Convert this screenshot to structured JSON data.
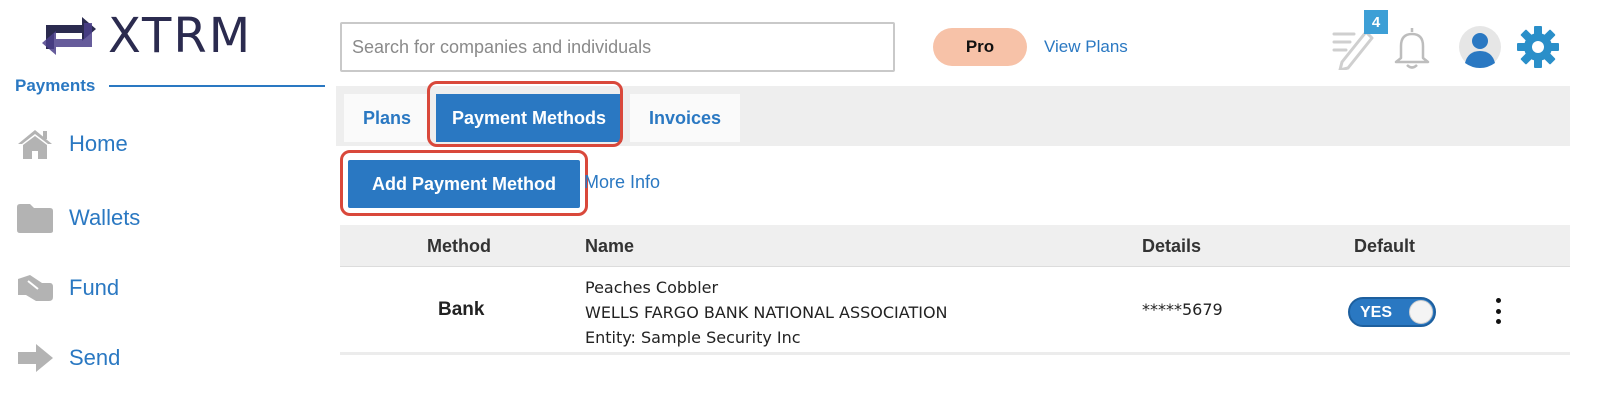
{
  "brand": {
    "name": "XTRM",
    "logo_icon": "xtrm-arrows-logo",
    "color": "#2b2b4f"
  },
  "colors": {
    "accent": "#2a78c2",
    "highlight": "#d9483b",
    "pro_badge": "#f7c2a8"
  },
  "sidebar": {
    "section_title": "Payments",
    "items": [
      {
        "label": "Home",
        "icon": "home-icon"
      },
      {
        "label": "Wallets",
        "icon": "folder-icon"
      },
      {
        "label": "Fund",
        "icon": "fund-icon"
      },
      {
        "label": "Send",
        "icon": "send-arrow-icon"
      }
    ]
  },
  "header": {
    "search_placeholder": "Search for companies and individuals",
    "plan_badge": "Pro",
    "view_plans": "View Plans",
    "notes_count": "4"
  },
  "tabs": [
    {
      "label": "Plans",
      "active": false
    },
    {
      "label": "Payment Methods",
      "active": true
    },
    {
      "label": "Invoices",
      "active": false
    }
  ],
  "actions": {
    "add_payment_method": "Add Payment Method",
    "more_info": "More Info"
  },
  "table": {
    "columns": [
      "Method",
      "Name",
      "Details",
      "Default"
    ],
    "rows": [
      {
        "method": "Bank",
        "name_lines": [
          "Peaches Cobbler",
          "WELLS FARGO BANK NATIONAL ASSOCIATION",
          "Entity: Sample Security Inc"
        ],
        "details": "*****5679",
        "default": "YES"
      }
    ]
  }
}
